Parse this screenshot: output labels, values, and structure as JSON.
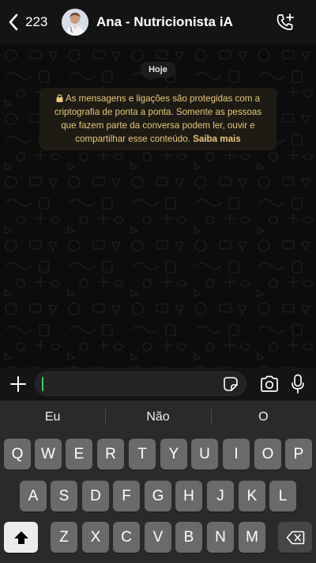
{
  "header": {
    "back_count": "223",
    "contact_name": "Ana - Nutricionista iA",
    "back_icon": "chevron-left-icon",
    "call_icon": "phone-plus-icon"
  },
  "chat": {
    "date_chip": "Hoje",
    "encryption_notice": "As mensagens e ligações são protegidas com a criptografia de ponta a ponta. Somente as pessoas que fazem parte da conversa podem ler, ouvir e compartilhar esse conteúdo.",
    "learn_more": "Saiba mais"
  },
  "composer": {
    "input_value": "",
    "input_placeholder": "",
    "icons": [
      "plus-icon",
      "sticker-icon",
      "camera-icon",
      "microphone-icon"
    ]
  },
  "keyboard": {
    "suggestions": [
      "Eu",
      "Não",
      "O"
    ],
    "row1": [
      "Q",
      "W",
      "E",
      "R",
      "T",
      "Y",
      "U",
      "I",
      "O",
      "P"
    ],
    "row2": [
      "A",
      "S",
      "D",
      "F",
      "G",
      "H",
      "J",
      "K",
      "L"
    ],
    "row3": [
      "Z",
      "X",
      "C",
      "V",
      "B",
      "N",
      "M"
    ],
    "special_icons": [
      "shift-icon",
      "backspace-icon"
    ]
  },
  "colors": {
    "accent": "#25d366",
    "encryption_text": "#e9c879",
    "chat_bg": "#0c0c0c",
    "key_bg": "#6a6a6a"
  }
}
